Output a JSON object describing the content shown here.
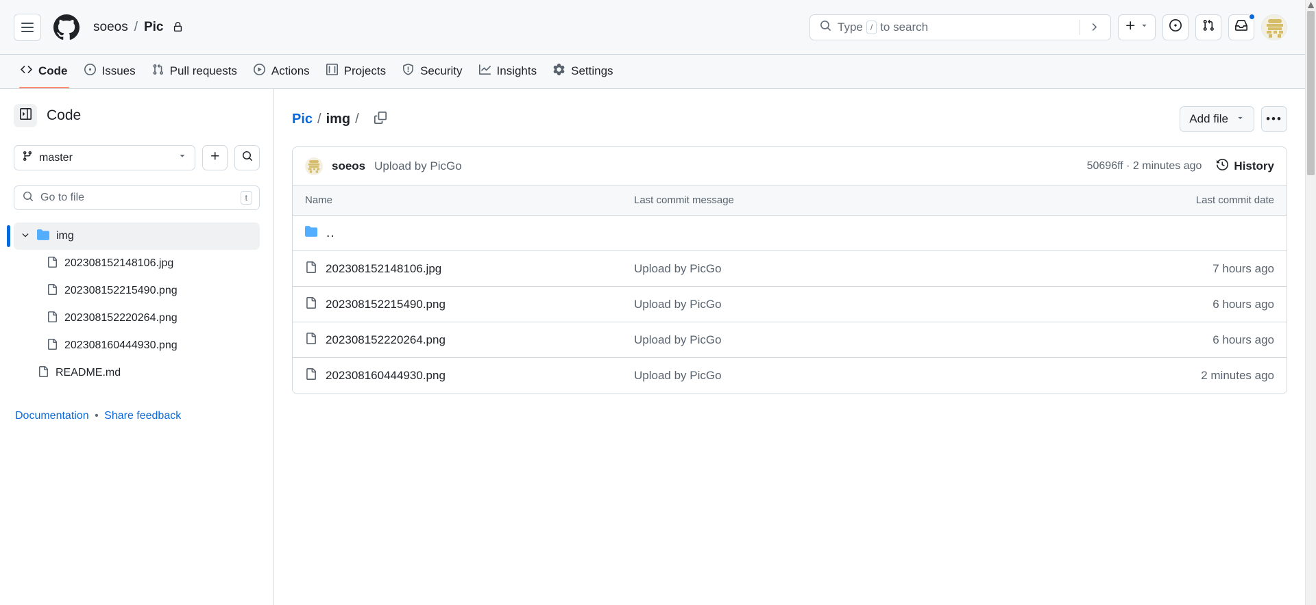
{
  "header": {
    "menu_icon": "hamburger-icon",
    "logo_icon": "github-mark-icon",
    "owner": "soeos",
    "separator": "/",
    "repo": "Pic",
    "visibility_icon": "lock-icon",
    "search": {
      "icon": "search-icon",
      "placeholder_pre": "Type",
      "key_badge": "/",
      "placeholder_post": "to search",
      "command_icon": "chevron-right-icon"
    },
    "actions": {
      "create_new_icon": "plus-icon",
      "create_new_caret": "triangle-down-icon",
      "issues_icon": "issue-opened-icon",
      "pull_requests_icon": "git-pull-request-icon",
      "notifications_icon": "inbox-icon",
      "notifications_badge": true,
      "avatar_icon": "user-avatar"
    }
  },
  "repo_nav": {
    "tabs": [
      {
        "label": "Code",
        "icon": "code-icon",
        "active": true
      },
      {
        "label": "Issues",
        "icon": "issue-opened-icon",
        "active": false
      },
      {
        "label": "Pull requests",
        "icon": "git-pull-request-icon",
        "active": false
      },
      {
        "label": "Actions",
        "icon": "play-icon",
        "active": false
      },
      {
        "label": "Projects",
        "icon": "table-icon",
        "active": false
      },
      {
        "label": "Security",
        "icon": "shield-icon",
        "active": false
      },
      {
        "label": "Insights",
        "icon": "graph-icon",
        "active": false
      },
      {
        "label": "Settings",
        "icon": "gear-icon",
        "active": false
      }
    ]
  },
  "sidebar": {
    "collapse_icon": "sidebar-collapse-icon",
    "title": "Code",
    "branch": {
      "icon": "git-branch-icon",
      "name": "master",
      "caret": "triangle-down-icon"
    },
    "add_icon": "plus-icon",
    "search_icon": "search-icon",
    "go_to_file": {
      "icon": "search-icon",
      "placeholder": "Go to file",
      "key_badge": "t"
    },
    "tree": [
      {
        "label": "img",
        "type": "folder",
        "selected": true,
        "chevron": "chevron-down-icon",
        "icon": "folder-icon"
      },
      {
        "label": "202308152148106.jpg",
        "type": "file",
        "selected": false,
        "icon": "file-icon"
      },
      {
        "label": "202308152215490.png",
        "type": "file",
        "selected": false,
        "icon": "file-icon"
      },
      {
        "label": "202308152220264.png",
        "type": "file",
        "selected": false,
        "icon": "file-icon"
      },
      {
        "label": "202308160444930.png",
        "type": "file",
        "selected": false,
        "icon": "file-icon"
      },
      {
        "label": "README.md",
        "type": "file",
        "selected": false,
        "icon": "file-icon",
        "root": true
      }
    ],
    "footer": {
      "documentation": "Documentation",
      "bullet": "•",
      "feedback": "Share feedback"
    }
  },
  "main": {
    "breadcrumb": {
      "root": "Pic",
      "sep1": "/",
      "current": "img",
      "sep2": "/",
      "copy_icon": "copy-path-icon"
    },
    "add_file": {
      "label": "Add file",
      "caret": "triangle-down-icon"
    },
    "more_button": "•••",
    "commit": {
      "avatar_icon": "user-avatar",
      "author": "soeos",
      "message": "Upload by PicGo",
      "hash_and_time": "50696ff · 2 minutes ago",
      "history_icon": "history-icon",
      "history_label": "History"
    },
    "table": {
      "columns": {
        "name": "Name",
        "message": "Last commit message",
        "date": "Last commit date"
      },
      "parent_row": {
        "icon": "folder-icon",
        "label": "..",
        "message": "",
        "date": ""
      },
      "rows": [
        {
          "icon": "file-icon",
          "name": "202308152148106.jpg",
          "message": "Upload by PicGo",
          "date": "7 hours ago"
        },
        {
          "icon": "file-icon",
          "name": "202308152215490.png",
          "message": "Upload by PicGo",
          "date": "6 hours ago"
        },
        {
          "icon": "file-icon",
          "name": "202308152220264.png",
          "message": "Upload by PicGo",
          "date": "6 hours ago"
        },
        {
          "icon": "file-icon",
          "name": "202308160444930.png",
          "message": "Upload by PicGo",
          "date": "2 minutes ago"
        }
      ]
    }
  },
  "scrollbar": {
    "up_arrow": "▲",
    "down_arrow": "▼"
  },
  "colors": {
    "accent": "#0969da",
    "active_tab_underline": "#fd8c73",
    "header_bg": "#f6f8fa",
    "border": "#d1d9e0",
    "muted_text": "#59636e",
    "avatar": "#d4bc68"
  }
}
